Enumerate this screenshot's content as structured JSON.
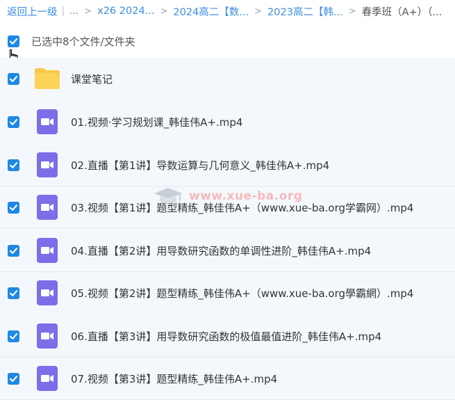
{
  "breadcrumb": {
    "back": "返回上一级",
    "ellipsis": "...",
    "items": [
      "x26 2024...",
      "2024高二【数...",
      "2023高二【韩..."
    ],
    "current": "春季班（A+）（..."
  },
  "selection": {
    "label": "已选中8个文件/文件夹"
  },
  "files": [
    {
      "name": "课堂笔记",
      "icon": "folder-icon"
    },
    {
      "name": "01.视频·学习规划课_韩佳伟A+.mp4",
      "icon": "video-file-icon"
    },
    {
      "name": "02.直播【第1讲】导数运算与几何意义_韩佳伟A+.mp4",
      "icon": "video-file-icon"
    },
    {
      "name": "03.视频【第1讲】题型精练_韩佳伟A+（www.xue-ba.org学霸网）.mp4",
      "icon": "video-file-icon"
    },
    {
      "name": "04.直播【第2讲】用导数研究函数的单调性进阶_韩佳伟A+.mp4",
      "icon": "video-file-icon"
    },
    {
      "name": "05.视频【第2讲】题型精练_韩佳伟A+（www.xue-ba.org學霸網）.mp4",
      "icon": "video-file-icon"
    },
    {
      "name": "06.直播【第3讲】用导数研究函数的极值最值进阶_韩佳伟A+.mp4",
      "icon": "video-file-icon"
    },
    {
      "name": "07.视频【第3讲】题型精练_韩佳伟A+.mp4",
      "icon": "video-file-icon"
    }
  ],
  "watermark": "www.xue-ba.org",
  "colors": {
    "link": "#3b8ee3",
    "checkbox": "#1e88e5",
    "row_bg": "#f4f8fc",
    "folder": "#f9c844",
    "video_icon": "#7a6fe8"
  }
}
